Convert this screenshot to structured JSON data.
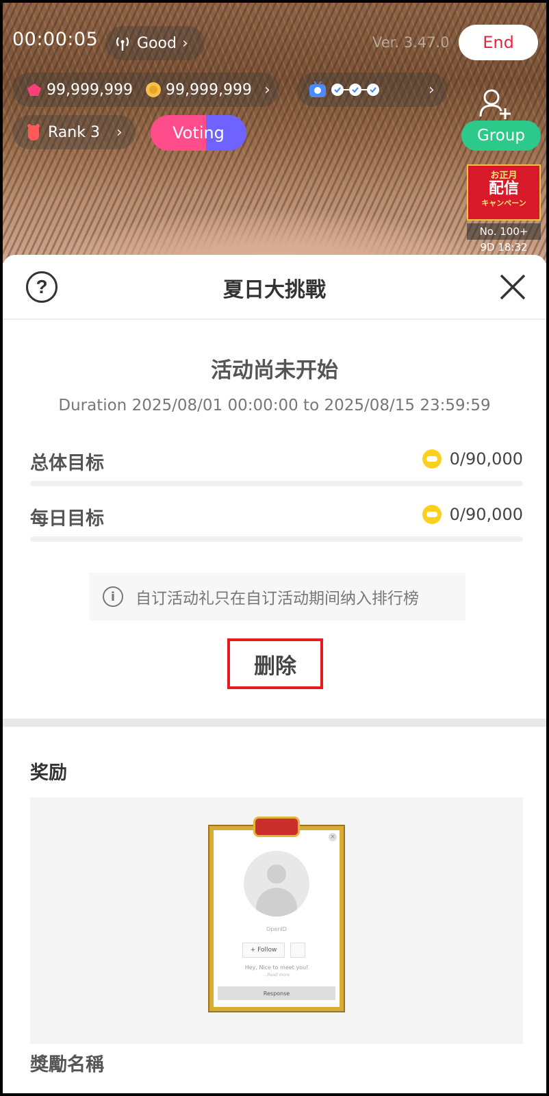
{
  "top_bar": {
    "timer": "00:00:05",
    "signal_label": "Good",
    "version": "Ver. 3.47.0",
    "end_label": "End",
    "diamonds": "99,999,999",
    "coins": "99,999,999",
    "rank_label": "Rank 3",
    "voting_label": "Voting",
    "group_label": "Group",
    "campaign": {
      "line1": "お正月",
      "line2": "配信",
      "line3": "キャンペーン",
      "rank": "No. 100+",
      "countdown": "9D 18:32"
    }
  },
  "sheet": {
    "title": "夏日大挑戰",
    "status": "活动尚未开始",
    "duration": "Duration 2025/08/01 00:00:00 to 2025/08/15 23:59:59",
    "goals": [
      {
        "label": "总体目标",
        "value": "0/90,000",
        "progress": 0
      },
      {
        "label": "每日目标",
        "value": "0/90,000",
        "progress": 0
      }
    ],
    "notice": "自订活动礼只在自订活动期间纳入排行榜",
    "delete_label": "删除",
    "reward_heading": "奖励",
    "reward_name_heading": "獎勵名稱",
    "reward_preview": {
      "name": "OpenID",
      "follow": "Follow",
      "greeting": "Hey, Nice to meet you!",
      "read_more": "...Read more",
      "response": "Response"
    }
  },
  "colors": {
    "end_text": "#e8263c",
    "group_bg": "#2dc98a",
    "voting_pink": "#ff4c8b",
    "voting_purple": "#6f63ff",
    "highlight_border": "#e8191f",
    "coin": "#ffcf1f"
  }
}
